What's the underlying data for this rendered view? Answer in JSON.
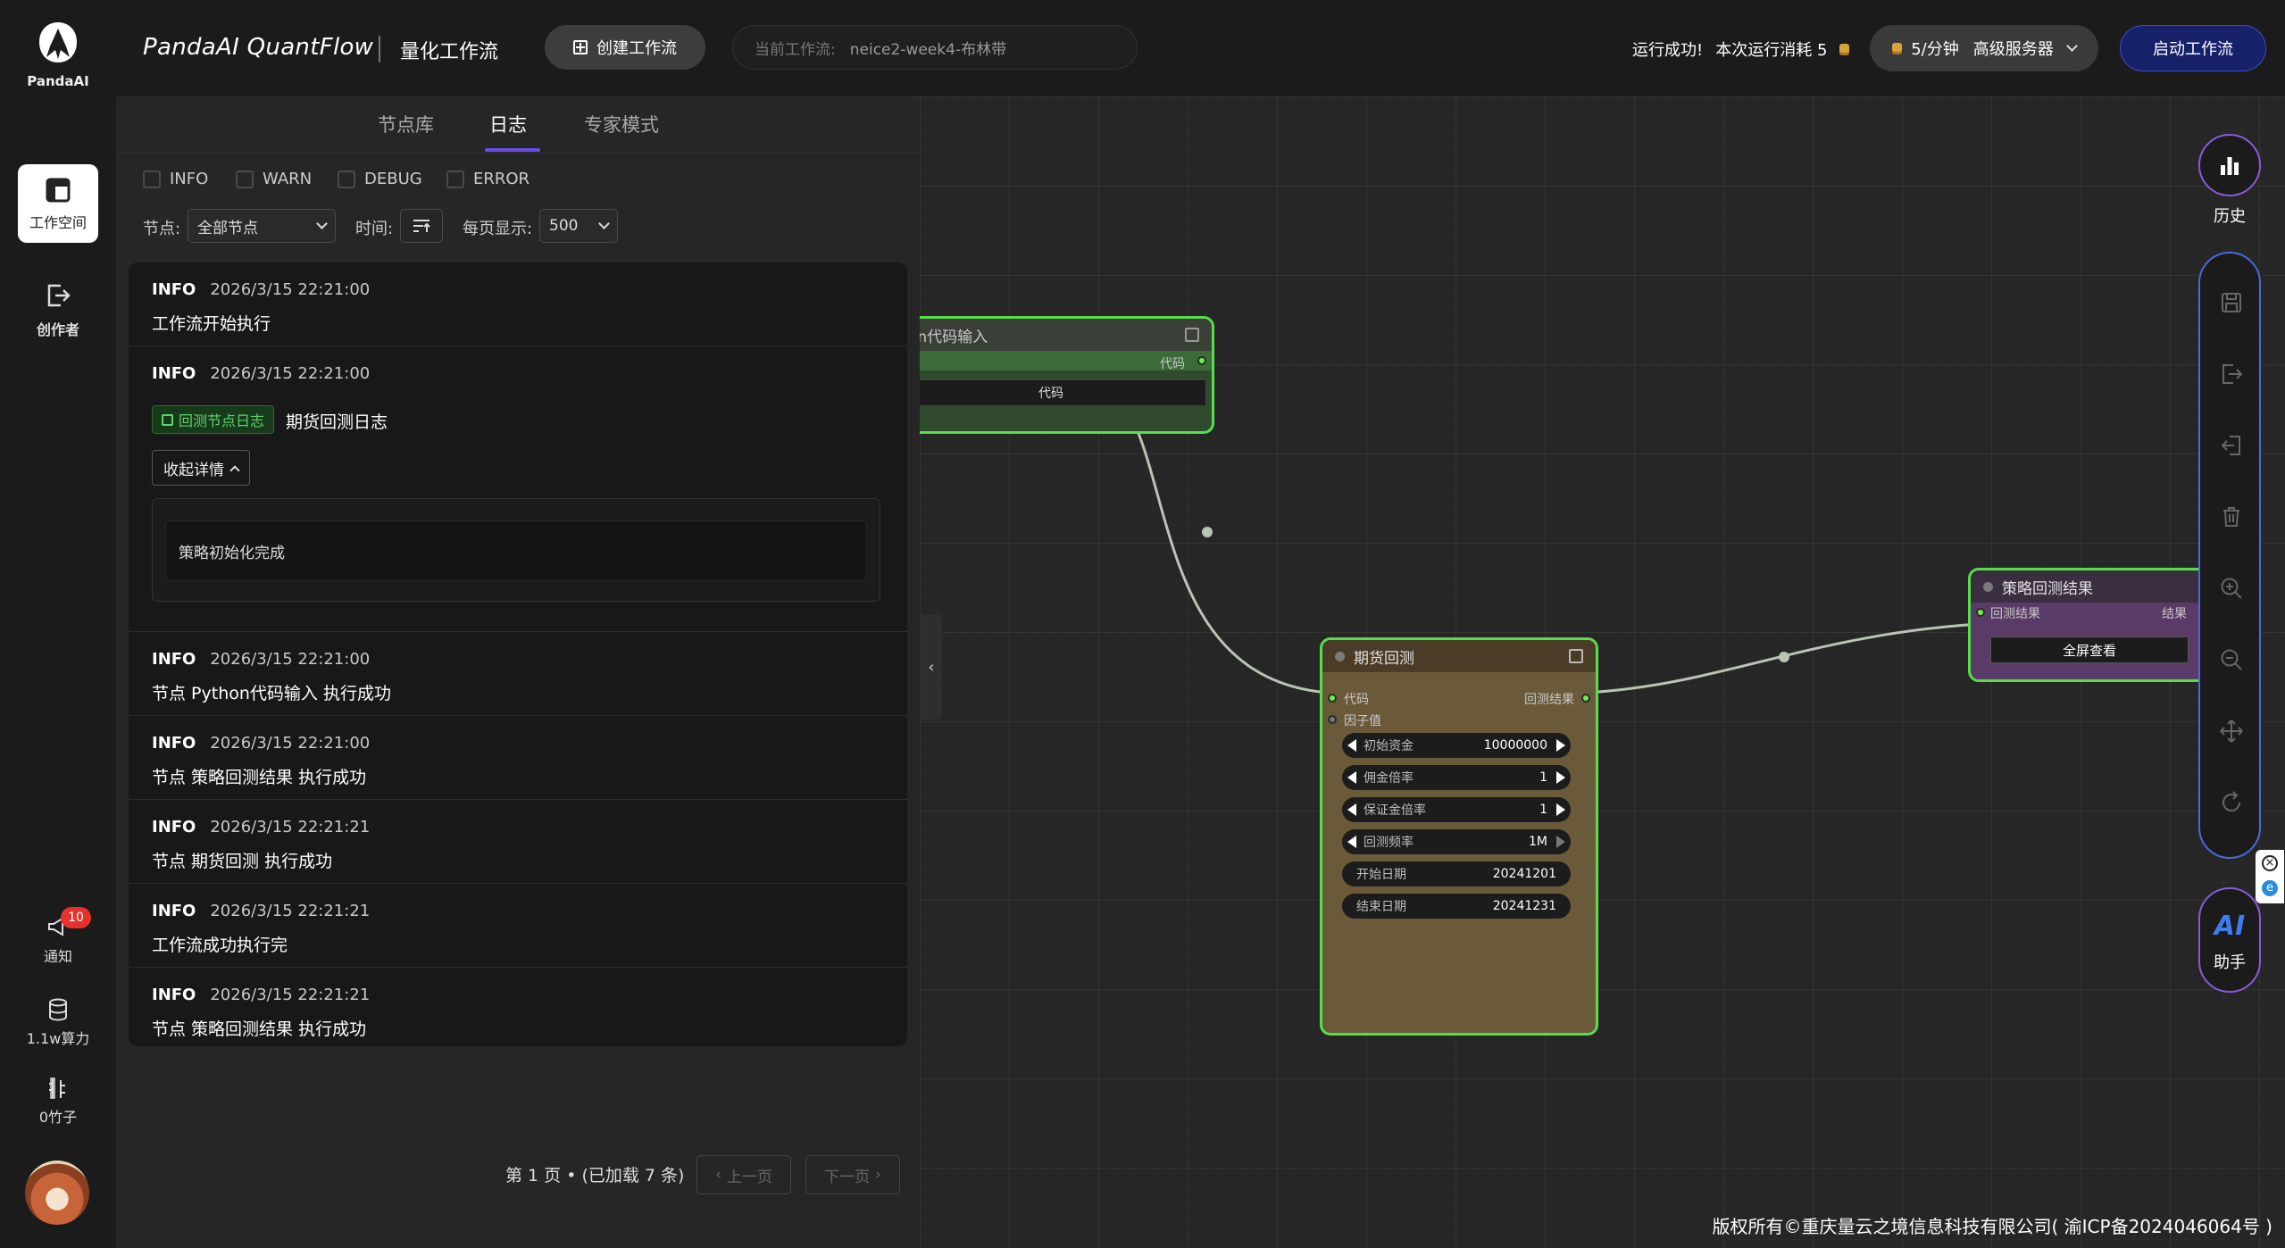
{
  "header": {
    "brand": "PandaAI",
    "title": "PandaAI QuantFlow",
    "subtitle": "量化工作流",
    "create_label": "创建工作流",
    "workflow_label": "当前工作流:",
    "workflow_name": "neice2-week4-布林带",
    "run_status": "运行成功!",
    "run_cost": "本次运行消耗 5",
    "rate": "5/分钟",
    "server": "高级服务器",
    "start_label": "启动工作流"
  },
  "sidebar": {
    "workspace": "工作空间",
    "creator": "创作者",
    "notify": "通知",
    "notify_count": "10",
    "compute": "1.1w算力",
    "bamboo": "0竹子"
  },
  "panel": {
    "tabs": [
      "节点库",
      "日志",
      "专家模式"
    ],
    "active_tab": "日志",
    "levels": [
      "INFO",
      "WARN",
      "DEBUG",
      "ERROR"
    ],
    "node_label": "节点:",
    "node_value": "全部节点",
    "time_label": "时间:",
    "per_page_label": "每页显示:",
    "per_page_value": "500",
    "logs": [
      {
        "level": "INFO",
        "time": "2026/3/15 22:21:00",
        "msg": "工作流开始执行"
      },
      {
        "level": "INFO",
        "time": "2026/3/15 22:21:00",
        "tag": "回测节点日志",
        "msg": "期货回测日志",
        "toggle": "收起详情",
        "detail": "策略初始化完成"
      },
      {
        "level": "INFO",
        "time": "2026/3/15 22:21:00",
        "msg": "节点 Python代码输入 执行成功"
      },
      {
        "level": "INFO",
        "time": "2026/3/15 22:21:00",
        "msg": "节点 策略回测结果 执行成功"
      },
      {
        "level": "INFO",
        "time": "2026/3/15 22:21:21",
        "msg": "节点 期货回测 执行成功"
      },
      {
        "level": "INFO",
        "time": "2026/3/15 22:21:21",
        "msg": "工作流成功执行完"
      },
      {
        "level": "INFO",
        "time": "2026/3/15 22:21:21",
        "msg": "节点 策略回测结果 执行成功"
      }
    ],
    "pager_text": "第 1 页 • (已加载 7 条)",
    "prev_label": "上一页",
    "next_label": "下一页"
  },
  "nodes": {
    "python": {
      "title": "on代码输入",
      "out_label": "代码",
      "field": "代码"
    },
    "futures": {
      "title": "期货回测",
      "in1": "代码",
      "in2": "因子值",
      "out": "回测结果",
      "widgets": [
        {
          "label": "初始资金",
          "value": "10000000"
        },
        {
          "label": "佣金倍率",
          "value": "1"
        },
        {
          "label": "保证金倍率",
          "value": "1"
        },
        {
          "label": "回测频率",
          "value": "1M"
        },
        {
          "label": "开始日期",
          "value": "20241201"
        },
        {
          "label": "结束日期",
          "value": "20241231"
        }
      ]
    },
    "result": {
      "title": "策略回测结果",
      "in": "回测结果",
      "out": "结果",
      "button": "全屏查看"
    }
  },
  "right_toolbar": {
    "history": "历史",
    "ai_title": "AI",
    "ai_label": "助手"
  },
  "footer": "版权所有©重庆量云之境信息科技有限公司( 渝ICP备2024046064号 )",
  "colors": {
    "accent_purple": "#6b4ce6",
    "node_border": "#55e04a",
    "start_button": "#16216a",
    "badge": "#e5322d"
  }
}
